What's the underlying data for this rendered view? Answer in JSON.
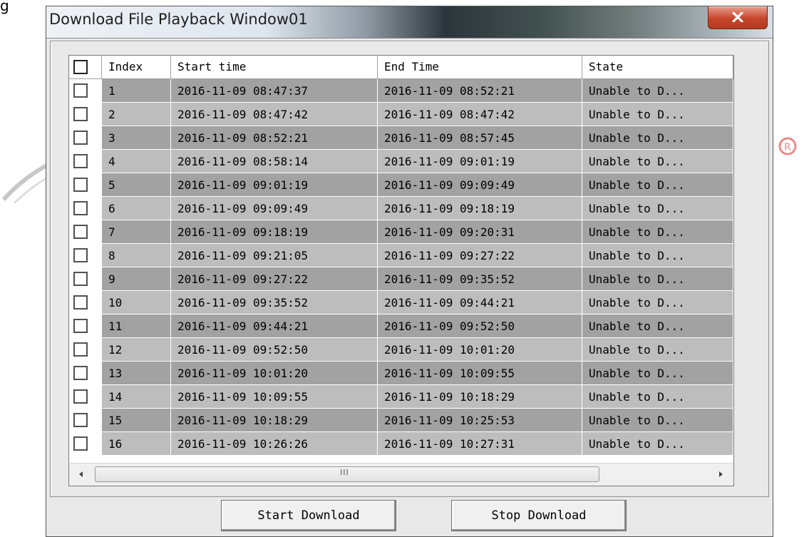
{
  "partial_text_top_left": "g",
  "window": {
    "title": "Download File Playback Window01"
  },
  "table": {
    "columns": [
      "",
      "Index",
      "Start time",
      "End Time",
      "State"
    ],
    "rows": [
      {
        "index": "1",
        "start": "2016-11-09 08:47:37",
        "end": "2016-11-09 08:52:21",
        "state": "Unable to D..."
      },
      {
        "index": "2",
        "start": "2016-11-09 08:47:42",
        "end": "2016-11-09 08:47:42",
        "state": "Unable to D..."
      },
      {
        "index": "3",
        "start": "2016-11-09 08:52:21",
        "end": "2016-11-09 08:57:45",
        "state": "Unable to D..."
      },
      {
        "index": "4",
        "start": "2016-11-09 08:58:14",
        "end": "2016-11-09 09:01:19",
        "state": "Unable to D..."
      },
      {
        "index": "5",
        "start": "2016-11-09 09:01:19",
        "end": "2016-11-09 09:09:49",
        "state": "Unable to D..."
      },
      {
        "index": "6",
        "start": "2016-11-09 09:09:49",
        "end": "2016-11-09 09:18:19",
        "state": "Unable to D..."
      },
      {
        "index": "7",
        "start": "2016-11-09 09:18:19",
        "end": "2016-11-09 09:20:31",
        "state": "Unable to D..."
      },
      {
        "index": "8",
        "start": "2016-11-09 09:21:05",
        "end": "2016-11-09 09:27:22",
        "state": "Unable to D..."
      },
      {
        "index": "9",
        "start": "2016-11-09 09:27:22",
        "end": "2016-11-09 09:35:52",
        "state": "Unable to D..."
      },
      {
        "index": "10",
        "start": "2016-11-09 09:35:52",
        "end": "2016-11-09 09:44:21",
        "state": "Unable to D..."
      },
      {
        "index": "11",
        "start": "2016-11-09 09:44:21",
        "end": "2016-11-09 09:52:50",
        "state": "Unable to D..."
      },
      {
        "index": "12",
        "start": "2016-11-09 09:52:50",
        "end": "2016-11-09 10:01:20",
        "state": "Unable to D..."
      },
      {
        "index": "13",
        "start": "2016-11-09 10:01:20",
        "end": "2016-11-09 10:09:55",
        "state": "Unable to D..."
      },
      {
        "index": "14",
        "start": "2016-11-09 10:09:55",
        "end": "2016-11-09 10:18:29",
        "state": "Unable to D..."
      },
      {
        "index": "15",
        "start": "2016-11-09 10:18:29",
        "end": "2016-11-09 10:25:53",
        "state": "Unable to D..."
      },
      {
        "index": "16",
        "start": "2016-11-09 10:26:26",
        "end": "2016-11-09 10:27:31",
        "state": "Unable to D..."
      }
    ]
  },
  "hscroll_grip": "III",
  "buttons": {
    "start_download": "Start Download",
    "stop_download": "Stop Download"
  },
  "icons": {
    "close": "close-icon",
    "scroll_up": "arrow-up-icon",
    "scroll_down": "arrow-down-icon",
    "scroll_left": "arrow-left-icon",
    "scroll_right": "arrow-right-icon",
    "watermark": "registered-icon"
  },
  "colors": {
    "row_dark": "#a2a2a2",
    "row_light": "#bdbdbd",
    "close_button": "#c6452b"
  }
}
